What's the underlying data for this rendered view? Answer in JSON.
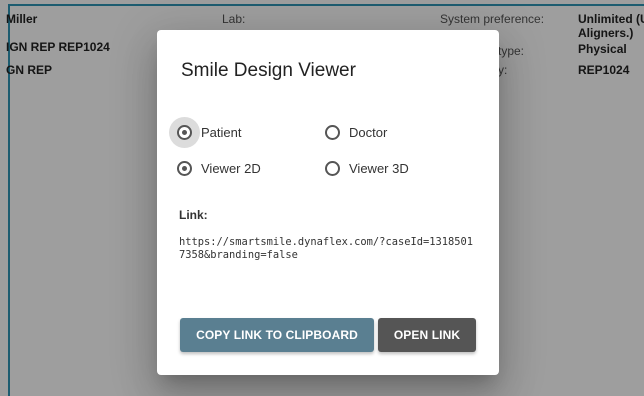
{
  "background": {
    "row1": {
      "name": "Miller",
      "lab_label": "Lab:",
      "system_pref_label": "System preference:",
      "system_pref_value": "Unlimited (U",
      "system_pref_value_2": "Aligners.)"
    },
    "row2": {
      "product": "IGN REP REP1024",
      "type_label": "type:",
      "type_value": "Physical"
    },
    "row3": {
      "product_short": "GN REP",
      "label_fragment": "y:",
      "value": "REP1024"
    }
  },
  "dialog": {
    "title": "Smile Design Viewer",
    "radio_group_1": [
      {
        "label": "Patient",
        "checked": true,
        "focused": true
      },
      {
        "label": "Doctor",
        "checked": false,
        "focused": false
      }
    ],
    "radio_group_2": [
      {
        "label": "Viewer 2D",
        "checked": true,
        "focused": false
      },
      {
        "label": "Viewer 3D",
        "checked": false,
        "focused": false
      }
    ],
    "link_label": "Link:",
    "link_url": "https://smartsmile.dynaflex.com/?caseId=13185017358&branding=false",
    "copy_button": "COPY LINK TO CLIPBOARD",
    "open_button": "OPEN LINK"
  },
  "colors": {
    "frame_accent": "#2f95b5",
    "copy_button_bg": "#5a7f91",
    "open_button_bg": "#555555"
  }
}
